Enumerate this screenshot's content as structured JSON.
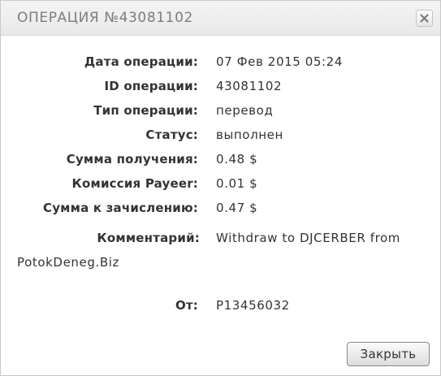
{
  "dialog": {
    "title": "ОПЕРАЦИЯ №43081102",
    "close_icon": "close-icon"
  },
  "fields": {
    "date": {
      "label": "Дата операции:",
      "value": "07 Фев 2015 05:24"
    },
    "id": {
      "label": "ID операции:",
      "value": "43081102"
    },
    "type": {
      "label": "Тип операции:",
      "value": "перевод"
    },
    "status": {
      "label": "Статус:",
      "value": "выполнен"
    },
    "received": {
      "label": "Сумма получения:",
      "value": "0.48 $"
    },
    "fee": {
      "label": "Комиссия Payeer:",
      "value": "0.01 $"
    },
    "credited": {
      "label": "Сумма к зачислению:",
      "value": "0.47 $"
    },
    "comment": {
      "label": "Комментарий:",
      "value": "Withdraw to DJCERBER from PotokDeneg.Biz"
    },
    "from": {
      "label": "От:",
      "value": "P13456032"
    }
  },
  "footer": {
    "close_label": "Закрыть"
  }
}
